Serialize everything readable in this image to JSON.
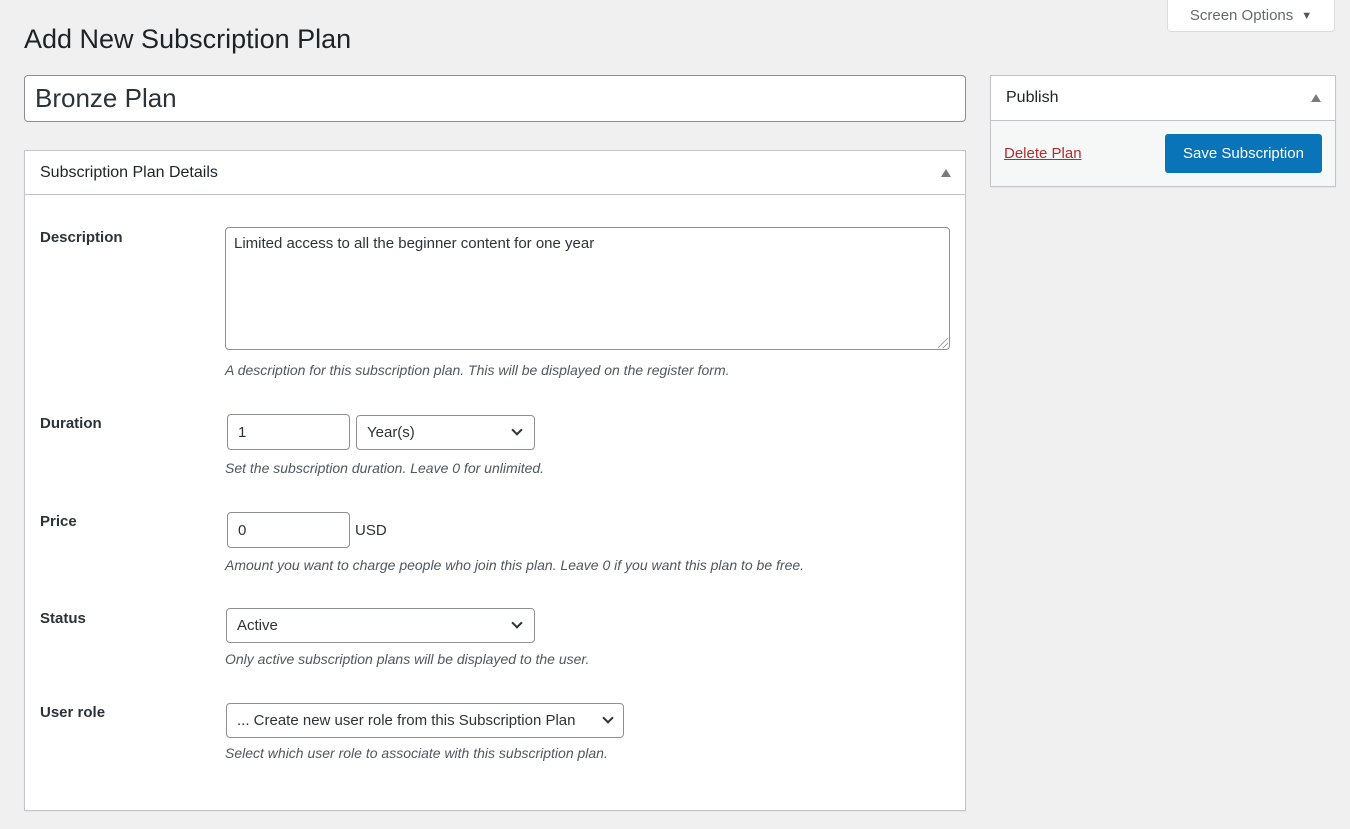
{
  "header": {
    "screen_options_label": "Screen Options",
    "page_title": "Add New Subscription Plan"
  },
  "title_field": {
    "value": "Bronze Plan"
  },
  "details_box": {
    "title": "Subscription Plan Details",
    "fields": {
      "description": {
        "label": "Description",
        "value": "Limited access to all the beginner content for one year",
        "help": "A description for this subscription plan. This will be displayed on the register form."
      },
      "duration": {
        "label": "Duration",
        "value": "1",
        "unit_selected": "Year(s)",
        "help": "Set the subscription duration. Leave 0 for unlimited."
      },
      "price": {
        "label": "Price",
        "value": "0",
        "currency": "USD",
        "help": "Amount you want to charge people who join this plan. Leave 0 if you want this plan to be free."
      },
      "status": {
        "label": "Status",
        "selected": "Active",
        "help": "Only active subscription plans will be displayed to the user."
      },
      "user_role": {
        "label": "User role",
        "selected": "... Create new user role from this Subscription Plan",
        "help": "Select which user role to associate with this subscription plan."
      }
    }
  },
  "publish_box": {
    "title": "Publish",
    "delete_label": "Delete Plan",
    "save_label": "Save Subscription"
  },
  "colors": {
    "primary_button": "#0a74b8",
    "delete_link": "#b32d2e",
    "background": "#f0f0f1"
  }
}
